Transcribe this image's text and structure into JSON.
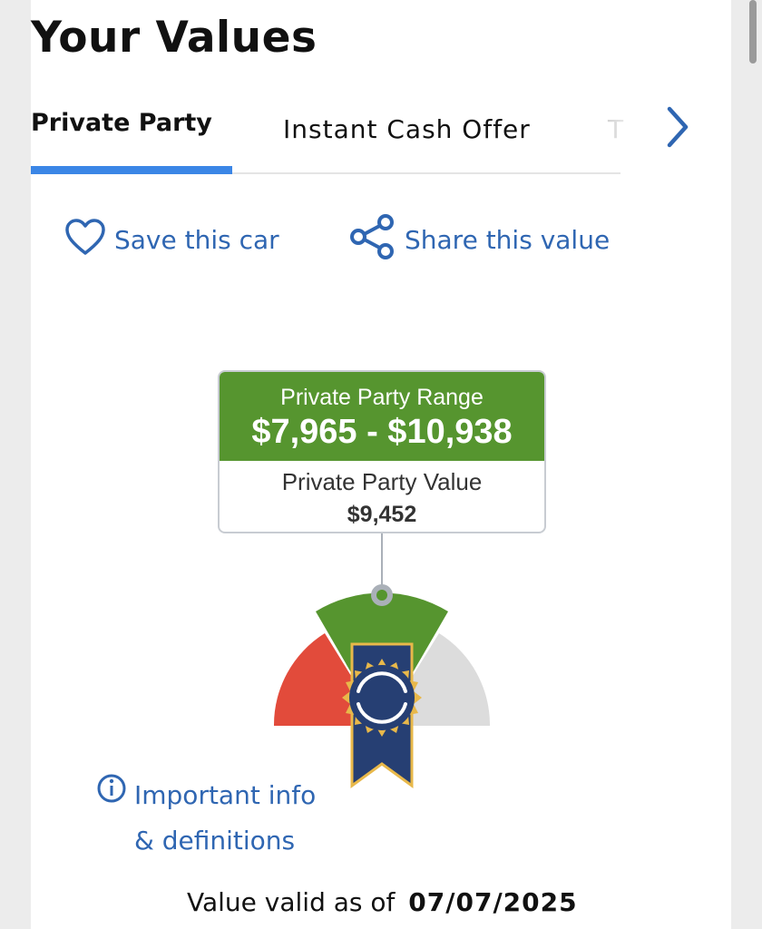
{
  "page": {
    "title": "Your Values"
  },
  "tabs": [
    {
      "label": "Private Party",
      "active": true
    },
    {
      "label": "Instant Cash Offer",
      "active": false
    },
    {
      "label": "T",
      "active": false
    }
  ],
  "actions": {
    "save_label": "Save this car",
    "share_label": "Share this value"
  },
  "valuation": {
    "range_label": "Private Party Range",
    "range_value": "$7,965 - $10,938",
    "value_label": "Private Party Value",
    "value_amount": "$9,452",
    "gauge_colors": {
      "low": "#e24b3b",
      "mid": "#56952f",
      "high": "#dcdcdc"
    }
  },
  "info": {
    "line1": "Important info",
    "line2": "& definitions"
  },
  "validity": {
    "prefix": "Value valid as of",
    "date": "07/07/2025"
  },
  "colors": {
    "accent": "#3b86e6",
    "link": "#2f66b2",
    "range_green": "#56952f",
    "ribbon_navy": "#263f73",
    "seal_gold": "#e8b84a"
  }
}
